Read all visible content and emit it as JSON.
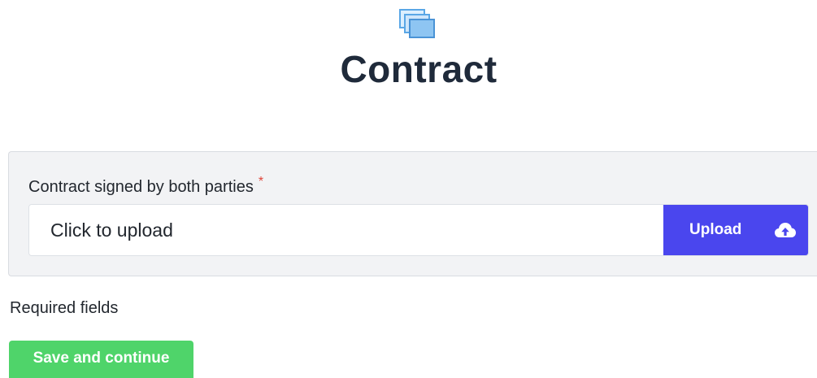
{
  "header": {
    "icon": "stacked-documents-icon",
    "title": "Contract"
  },
  "contract_field": {
    "label": "Contract signed by both parties",
    "required_marker": "*",
    "placeholder": "Click to upload",
    "upload_button_label": "Upload",
    "upload_icon": "cloud-upload-icon"
  },
  "footer": {
    "required_note": "Required fields",
    "save_button_label": "Save and continue"
  },
  "colors": {
    "accent_blue": "#4a46ee",
    "save_green": "#4fd46a",
    "required_red": "#e0463b",
    "icon_blue": "#5aa7e6",
    "panel_bg": "#f2f3f5",
    "title_text": "#1f2a3a"
  }
}
